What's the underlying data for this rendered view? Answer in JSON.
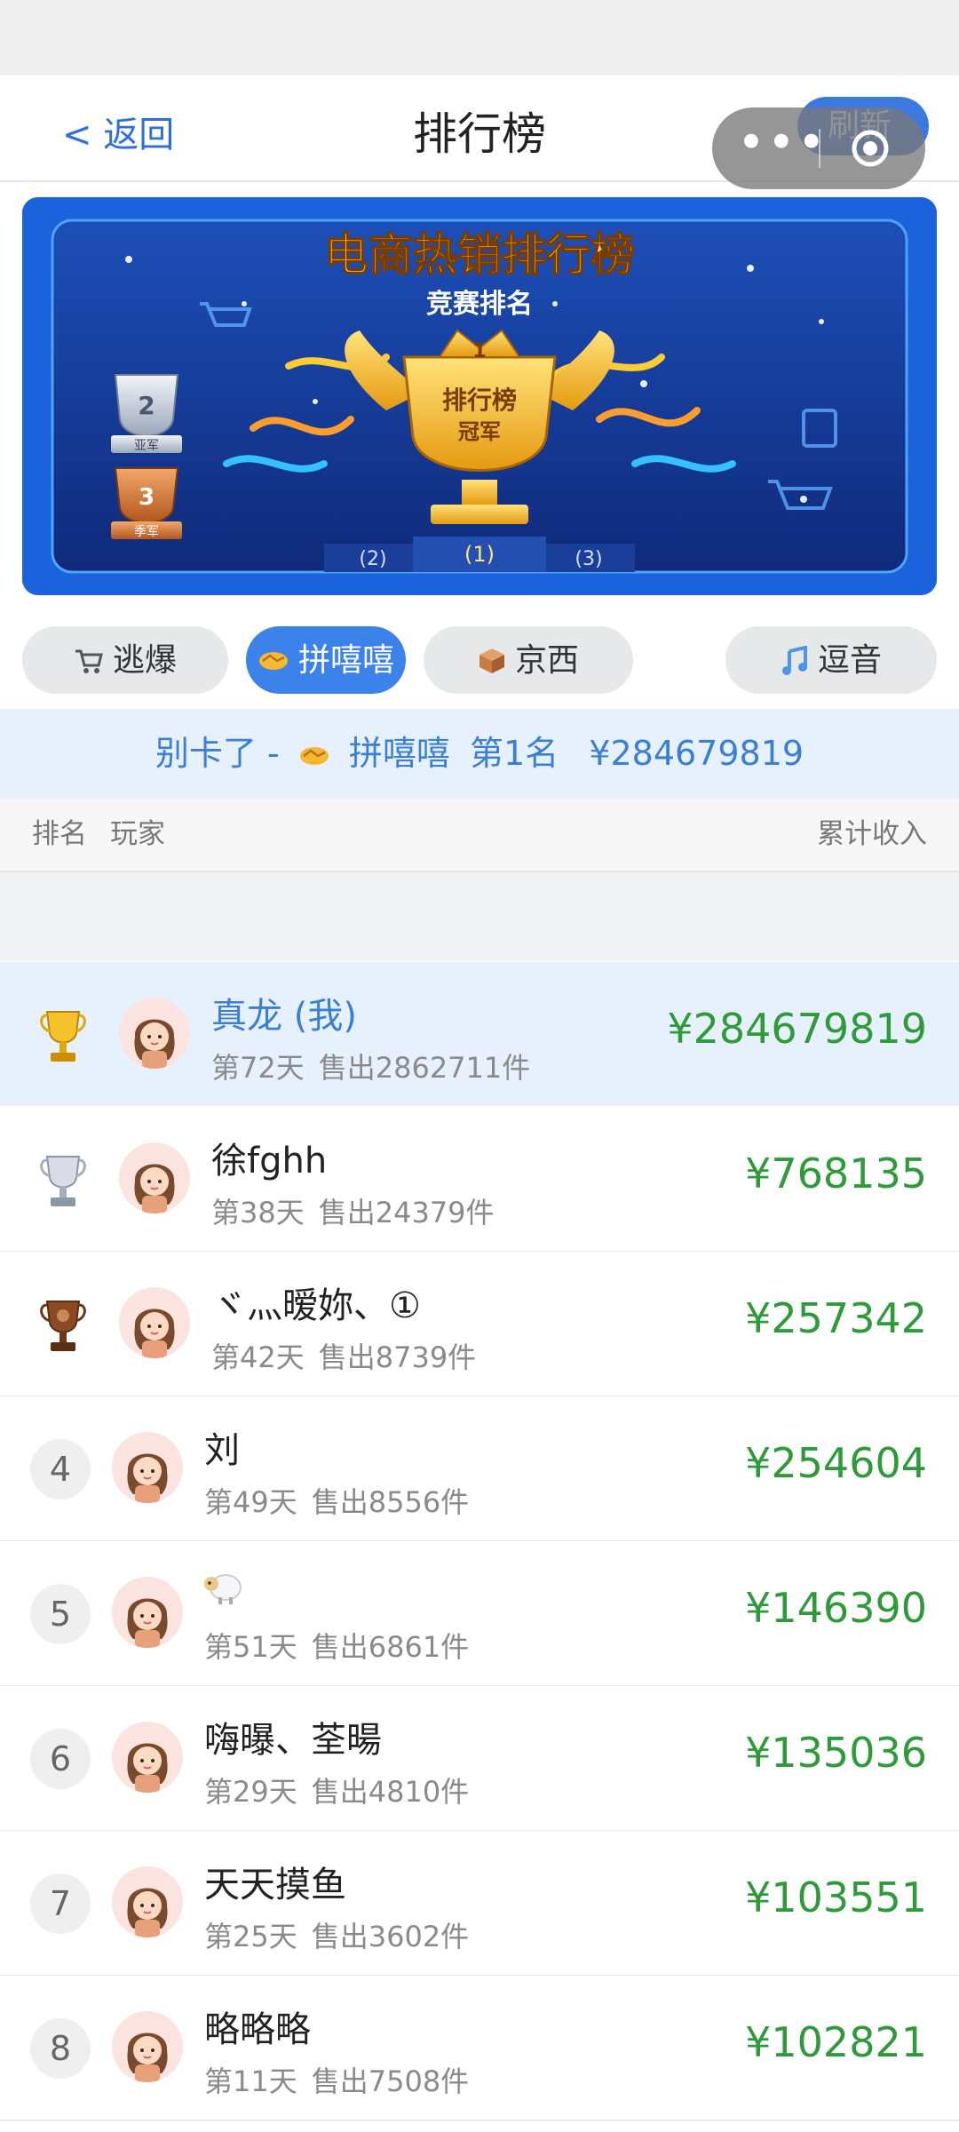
{
  "nav": {
    "back_label": "< 返回",
    "title": "排行榜",
    "refresh_label": "刷新"
  },
  "banner": {
    "title": "电商热销排行榜",
    "subtitle": "竞赛排名",
    "cup_text_1": "排行榜",
    "cup_text_2": "冠军",
    "second_label": "亚军",
    "third_label": "季军",
    "podium": [
      "(2)",
      "(1)",
      "(3)"
    ],
    "cup_number": "1"
  },
  "tabs": [
    {
      "icon": "cart-icon",
      "label": "逃爆",
      "active": false
    },
    {
      "icon": "handshake-icon",
      "label": "拼嘻嘻",
      "active": true
    },
    {
      "icon": "package-icon",
      "label": "京西",
      "active": false
    },
    {
      "icon": "music-note-icon",
      "label": "逗音",
      "active": false
    }
  ],
  "notice": {
    "prefix": "别卡了 -",
    "platform": "拼嘻嘻",
    "rank": "第1名",
    "amount": "¥284679819"
  },
  "table_header": {
    "rank": "排名",
    "player": "玩家",
    "income": "累计收入"
  },
  "rows": [
    {
      "rank": "1",
      "medal": "gold-trophy-icon",
      "name": "真龙 (我)",
      "day": "第72天",
      "sold": "售出2862711件",
      "income": "¥284679819",
      "is_me": true
    },
    {
      "rank": "2",
      "medal": "silver-trophy-icon",
      "name": "徐fghh",
      "day": "第38天",
      "sold": "售出24379件",
      "income": "¥768135",
      "is_me": false
    },
    {
      "rank": "3",
      "medal": "bronze-trophy-icon",
      "name": "ヾ灬暧妳、①",
      "day": "第42天",
      "sold": "售出8739件",
      "income": "¥257342",
      "is_me": false
    },
    {
      "rank": "4",
      "name": "刘",
      "day": "第49天",
      "sold": "售出8556件",
      "income": "¥254604",
      "is_me": false
    },
    {
      "rank": "5",
      "name": "",
      "name_icon": "sheep-icon",
      "day": "第51天",
      "sold": "售出6861件",
      "income": "¥146390",
      "is_me": false
    },
    {
      "rank": "6",
      "name": "嗨曝、荃暘",
      "day": "第29天",
      "sold": "售出4810件",
      "income": "¥135036",
      "is_me": false
    },
    {
      "rank": "7",
      "name": "天天摸鱼",
      "day": "第25天",
      "sold": "售出3602件",
      "income": "¥103551",
      "is_me": false
    },
    {
      "rank": "8",
      "name": "略略略",
      "day": "第11天",
      "sold": "售出7508件",
      "income": "¥102821",
      "is_me": false
    }
  ],
  "colors": {
    "accent_blue": "#3b82ea",
    "highlight_bg": "#e6f1fd",
    "income_green": "#2e9a3a"
  }
}
